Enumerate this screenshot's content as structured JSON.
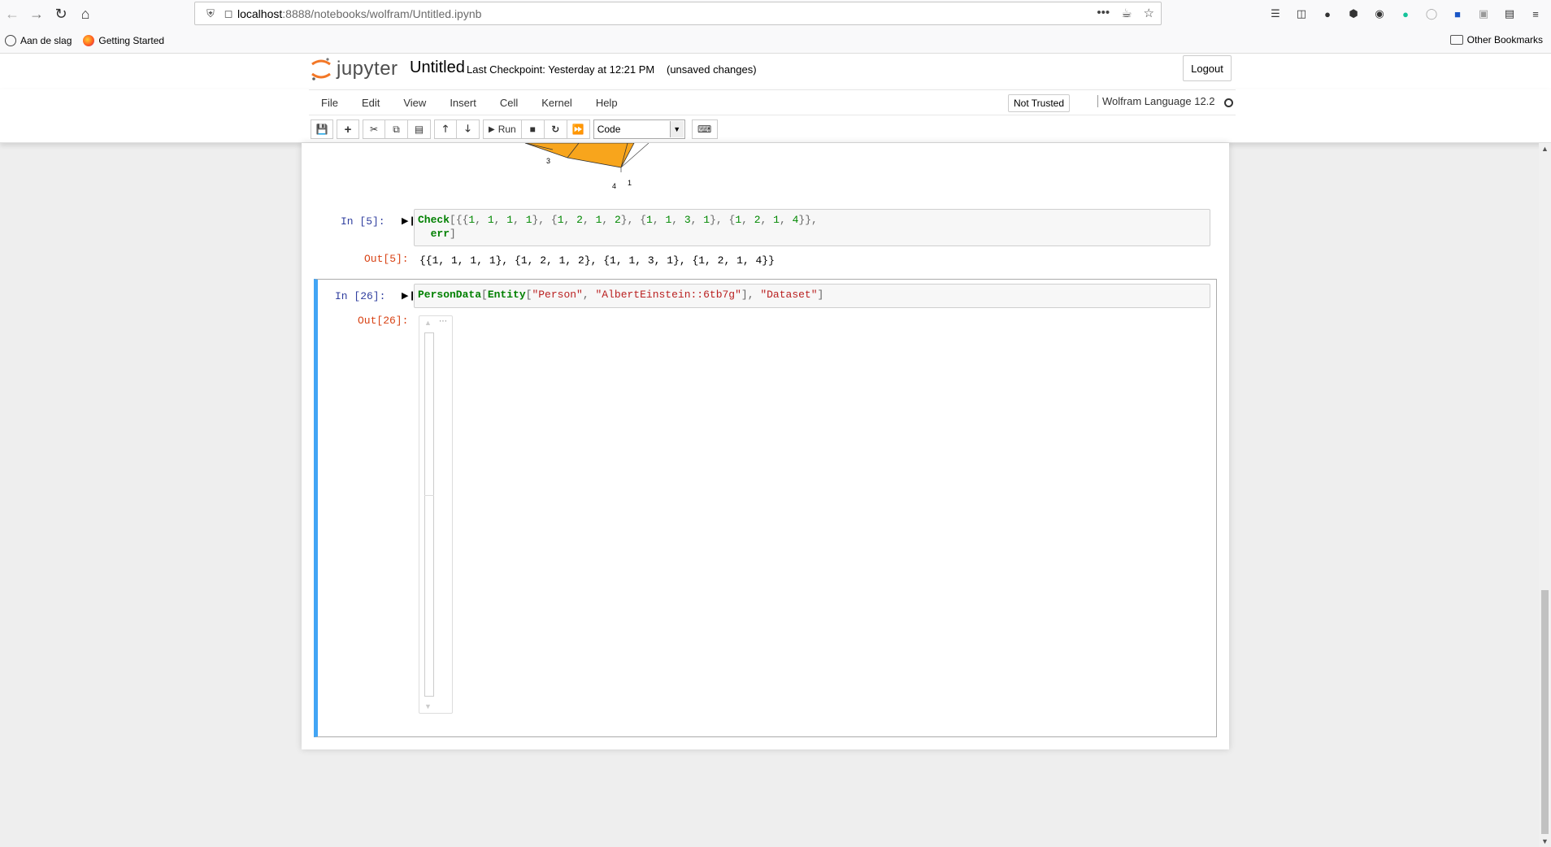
{
  "browser": {
    "url_host": "localhost",
    "url_path": ":8888/notebooks/wolfram/Untitled.ipynb",
    "url_more": "•••",
    "bookmarks": [
      {
        "label": "Aan de slag"
      },
      {
        "label": "Getting Started"
      }
    ],
    "other_bookmarks": "Other Bookmarks"
  },
  "header": {
    "logo_text": "jupyter",
    "notebook_name": "Untitled",
    "checkpoint": "Last Checkpoint: Yesterday at 12:21 PM",
    "unsaved": "(unsaved changes)",
    "logout": "Logout"
  },
  "menubar": {
    "items": [
      "File",
      "Edit",
      "View",
      "Insert",
      "Cell",
      "Kernel",
      "Help"
    ],
    "not_trusted": "Not Trusted",
    "kernel": "Wolfram Language 12.2"
  },
  "toolbar": {
    "run_label": "Run",
    "cell_type": "Code"
  },
  "notebook": {
    "plot_ticks": [
      "3",
      "4",
      "1"
    ],
    "cell5": {
      "in_prompt": "In [5]:",
      "out_prompt": "Out[5]:",
      "output": "{{1, 1, 1, 1}, {1, 2, 1, 2}, {1, 1, 3, 1}, {1, 2, 1, 4}}"
    },
    "cell26": {
      "in_prompt": "In [26]:",
      "out_prompt": "Out[26]:"
    }
  },
  "colors": {
    "selected_cell_bar": "#42a5f5",
    "in_prompt": "#303f9f",
    "out_prompt": "#d84315"
  }
}
